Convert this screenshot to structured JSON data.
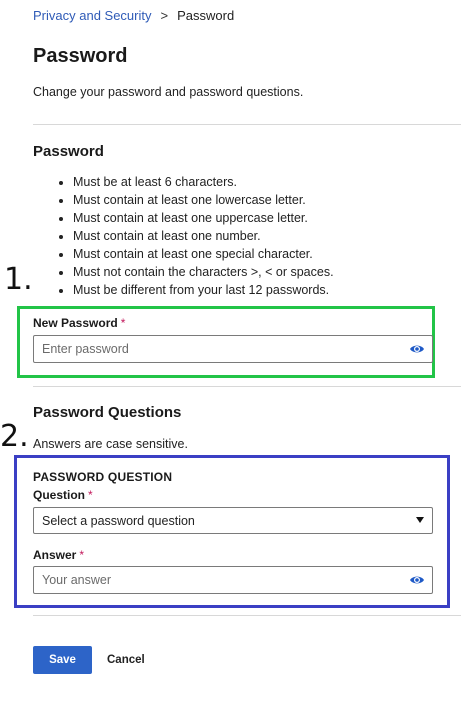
{
  "breadcrumb": {
    "parent": "Privacy and Security",
    "separator": ">",
    "current": "Password"
  },
  "page": {
    "title": "Password",
    "subtitle": "Change your password and password questions."
  },
  "password_section": {
    "heading": "Password",
    "rules": [
      "Must be at least 6 characters.",
      "Must contain at least one lowercase letter.",
      "Must contain at least one uppercase letter.",
      "Must contain at least one number.",
      "Must contain at least one special character.",
      "Must not contain the characters >, < or spaces.",
      "Must be different from your last 12 passwords."
    ],
    "new_password": {
      "label": "New Password",
      "required_mark": "*",
      "placeholder": "Enter password",
      "value": ""
    }
  },
  "annotations": {
    "step1": "1.",
    "step2": "2."
  },
  "questions_section": {
    "heading": "Password Questions",
    "note": "Answers are case sensitive.",
    "group_heading": "PASSWORD QUESTION",
    "question": {
      "label": "Question",
      "required_mark": "*",
      "selected": "Select a password question"
    },
    "answer": {
      "label": "Answer",
      "required_mark": "*",
      "placeholder": "Your answer",
      "value": ""
    }
  },
  "actions": {
    "save": "Save",
    "cancel": "Cancel"
  },
  "colors": {
    "accent": "#2d64c8",
    "link": "#2f5bb7",
    "required": "#c2185b",
    "highlight_green": "#22c447",
    "highlight_blue": "#3b3fc4"
  },
  "icons": {
    "password_toggle": "eye-icon",
    "select_arrow": "caret-down-icon"
  }
}
